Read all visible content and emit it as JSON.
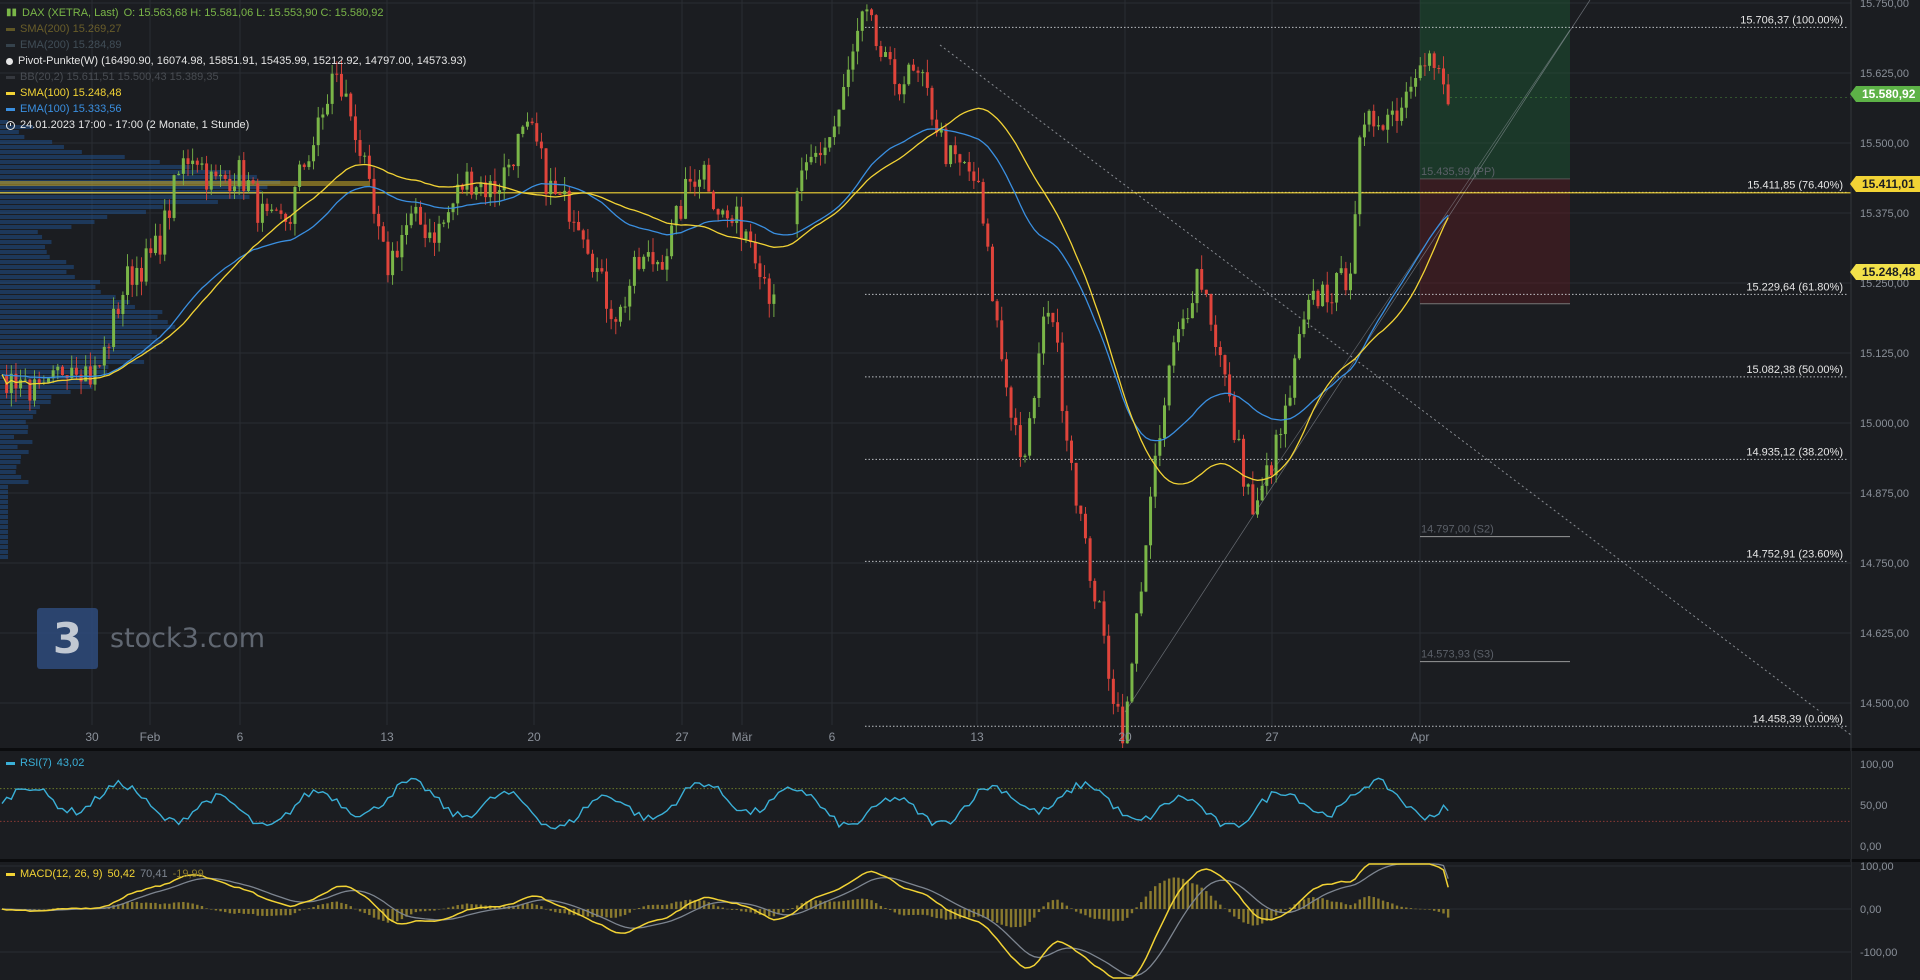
{
  "header": {
    "instrument": "DAX (XETRA, Last)",
    "ohlc": "O: 15.563,68  H: 15.581,06  L: 15.553,90  C: 15.580,92",
    "sma200": "SMA(200)  15.269,27",
    "ema200": "EMA(200)  15.284,89",
    "pivot": "Pivot-Punkte(W)  (16490.90,  16074.98,  15851.91,  15435.99,  15212.92,  14797.00,  14573.93)",
    "bb": "BB(20,2)  15.611,51  15.500,43  15.389,35",
    "sma100": "SMA(100)  15.248,48",
    "ema100": "EMA(100)  15.333,56",
    "period": "24.01.2023 17:00 - 17:00   (2 Monate, 1 Stunde)"
  },
  "watermark": {
    "logo": "3",
    "text": "stock3.com"
  },
  "price_axis": {
    "ticks": [
      "15.750,00",
      "15.625,00",
      "15.500,00",
      "15.375,00",
      "15.250,00",
      "15.125,00",
      "15.000,00",
      "14.875,00",
      "14.750,00",
      "14.625,00",
      "14.500,00"
    ],
    "badge_last": "15.580,92",
    "badge_pivot": "15.411,01",
    "badge_sma": "15.248,48"
  },
  "fib_levels": [
    {
      "label": "15.706,37 (100.00%)",
      "price": 15706.37
    },
    {
      "label": "15.411,85 (76.40%)",
      "price": 15411.85
    },
    {
      "label": "15.229,64 (61.80%)",
      "price": 15229.64
    },
    {
      "label": "15.082,38 (50.00%)",
      "price": 15082.38
    },
    {
      "label": "14.935,12 (38.20%)",
      "price": 14935.12
    },
    {
      "label": "14.752,91 (23.60%)",
      "price": 14752.91
    },
    {
      "label": "14.458,39 (0.00%)",
      "price": 14458.39
    }
  ],
  "pivot_labels": [
    {
      "label": "15.435,99 (PP)",
      "price": 15435.99
    },
    {
      "label": "14.797,00 (S2)",
      "price": 14797.0
    },
    {
      "label": "14.573,93 (S3)",
      "price": 14573.93
    }
  ],
  "time_axis": [
    "30",
    "Feb",
    "6",
    "13",
    "20",
    "27",
    "Mär",
    "6",
    "13",
    "20",
    "27",
    "Apr"
  ],
  "rsi": {
    "label": "RSI(7)",
    "value": "43,02",
    "ticks": [
      "100,00",
      "50,00",
      "0,00"
    ]
  },
  "macd": {
    "label": "MACD(12, 26, 9)",
    "value": "50,42",
    "signal": "70,41",
    "hist": "-19,99",
    "ticks": [
      "100,00",
      "0,00",
      "-100,00"
    ]
  },
  "colors": {
    "background": "#1b1d21",
    "up": "#7ab648",
    "down": "#e0443b",
    "sma100": "#f2d335",
    "ema100": "#3a8fe0",
    "rsi": "#3ab0d8",
    "macd": "#f2d335",
    "last_badge": "#5db247"
  },
  "chart_data": {
    "type": "candlestick",
    "title": "DAX (XETRA, Last)",
    "interval": "1 hour",
    "period": "24.01.2023 17:00 - 17:00 (2 Monate, 1 Stunde)",
    "ylim": [
      14450,
      15760
    ],
    "last": {
      "open": 15563.68,
      "high": 15581.06,
      "low": 15553.9,
      "close": 15580.92
    },
    "overlays": {
      "SMA(100)": 15248.48,
      "EMA(100)": 15333.56,
      "SMA(200)": 15269.27,
      "EMA(200)": 15284.89
    },
    "key_points": [
      {
        "time": "24.01",
        "price": 15050
      },
      {
        "time": "30.01",
        "price": 15100
      },
      {
        "time": "03.02",
        "price": 15480
      },
      {
        "time": "08.02",
        "price": 15350
      },
      {
        "time": "10.02",
        "price": 15640
      },
      {
        "time": "13.02",
        "price": 15300
      },
      {
        "time": "20.02",
        "price": 15500
      },
      {
        "time": "24.02",
        "price": 15200
      },
      {
        "time": "28.02",
        "price": 15450
      },
      {
        "time": "03.03",
        "price": 15250
      },
      {
        "time": "07.03",
        "price": 15700
      },
      {
        "time": "10.03",
        "price": 15550
      },
      {
        "time": "13.03",
        "price": 15400
      },
      {
        "time": "15.03",
        "price": 14900
      },
      {
        "time": "16.03",
        "price": 15250
      },
      {
        "time": "17.03",
        "price": 14750
      },
      {
        "time": "20.03",
        "price": 14460
      },
      {
        "time": "22.03",
        "price": 15150
      },
      {
        "time": "23.03",
        "price": 15250
      },
      {
        "time": "24.03",
        "price": 15100
      },
      {
        "time": "27.03",
        "price": 14800
      },
      {
        "time": "28.03",
        "price": 15150
      },
      {
        "time": "29.03",
        "price": 15300
      },
      {
        "time": "30.03",
        "price": 15480
      },
      {
        "time": "03.04",
        "price": 15650
      },
      {
        "time": "04.04",
        "price": 15580
      }
    ],
    "rsi_last": 43.02,
    "macd_last": {
      "macd": 50.42,
      "signal": 70.41,
      "histogram": -19.99
    }
  }
}
